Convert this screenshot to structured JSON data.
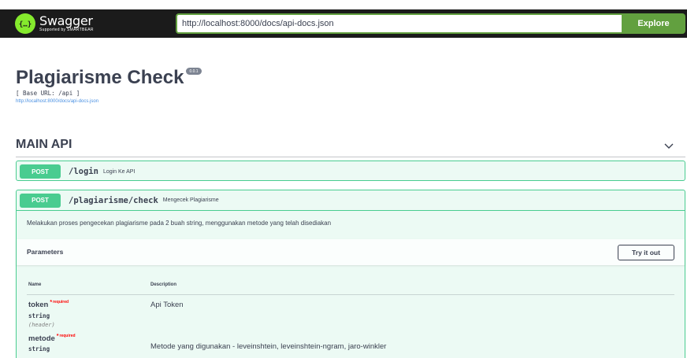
{
  "topbar": {
    "logo_name": "Swagger",
    "logo_sub": "Supported by SMARTBEAR",
    "url_value": "http://localhost:8000/docs/api-docs.json",
    "explore_label": "Explore"
  },
  "info": {
    "title": "Plagiarisme Check",
    "version": "0.0.1",
    "base_url": "[ Base URL: /api ]",
    "docs_link": "http://localhost:8000/docs/api-docs.json"
  },
  "section": {
    "title": "MAIN API"
  },
  "operations": [
    {
      "method": "POST",
      "path": "/login",
      "summary": "Login Ke API"
    },
    {
      "method": "POST",
      "path": "/plagiarisme/check",
      "summary": "Mengecek Plagiarisme",
      "description": "Melakukan proses pengecekan plagiarisme pada 2 buah string, menggunakan metode yang telah disediakan",
      "parameters_title": "Parameters",
      "try_label": "Try it out",
      "col_name": "Name",
      "col_description": "Description",
      "required_label": "required",
      "params": [
        {
          "name": "token",
          "type": "string",
          "in": "(header)",
          "description": "Api Token"
        },
        {
          "name": "metode",
          "type": "string",
          "description": "Metode yang digunakan - leveinshtein, leveinshtein-ngram, jaro-winkler"
        }
      ]
    }
  ],
  "colors": {
    "post": "#49cc90",
    "explore": "#62a03f",
    "topbar": "#1b1b1b",
    "required": "#ff0000",
    "link": "#4990e2"
  }
}
